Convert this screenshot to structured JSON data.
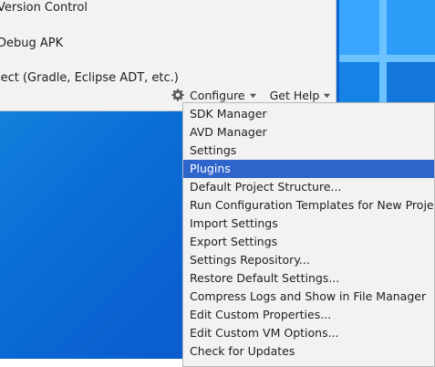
{
  "welcome": {
    "actions": [
      {
        "label": "Version Control"
      },
      {
        "label": "Debug APK"
      },
      {
        "label": "ject (Gradle, Eclipse ADT, etc.)"
      }
    ],
    "configure_label": "Configure",
    "get_help_label": "Get Help"
  },
  "menu": {
    "items": [
      {
        "label": "SDK Manager"
      },
      {
        "label": "AVD Manager"
      },
      {
        "label": "Settings"
      },
      {
        "label": "Plugins",
        "selected": true
      },
      {
        "label": "Default Project Structure..."
      },
      {
        "label": "Run Configuration Templates for New Projects..."
      },
      {
        "label": "Import Settings"
      },
      {
        "label": "Export Settings"
      },
      {
        "label": "Settings Repository..."
      },
      {
        "label": "Restore Default Settings..."
      },
      {
        "label": "Compress Logs and Show in File Manager"
      },
      {
        "label": "Edit Custom Properties..."
      },
      {
        "label": "Edit Custom VM Options..."
      },
      {
        "label": "Check for Updates"
      }
    ]
  },
  "colors": {
    "selection": "#2f65ca",
    "desktop": "#0b5fcf",
    "panel": "#f2f2f2"
  }
}
